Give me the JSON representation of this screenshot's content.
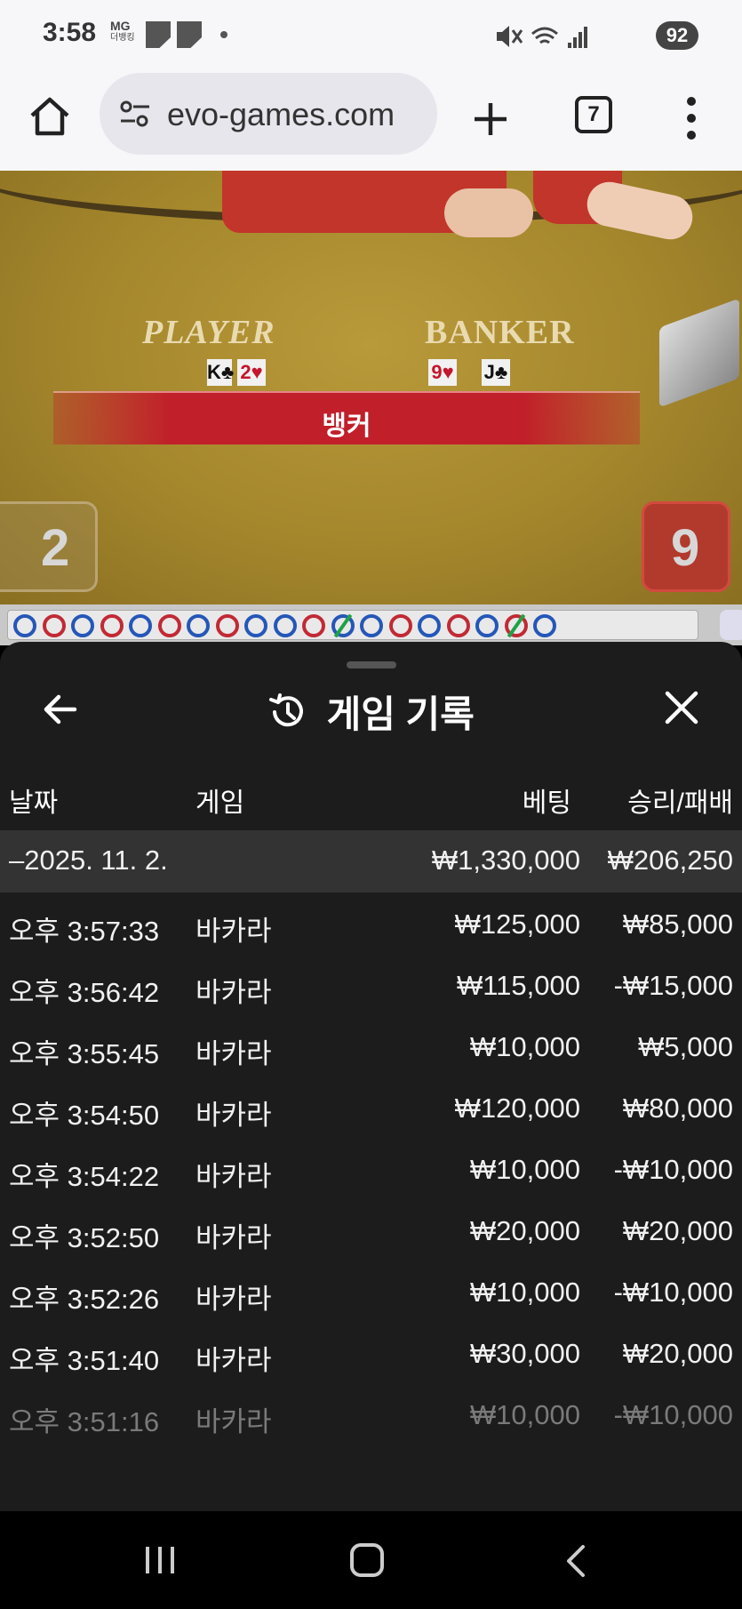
{
  "status_bar": {
    "time": "3:58",
    "carrier_top": "MG",
    "carrier_bottom": "더뱅킹",
    "battery": "92"
  },
  "browser": {
    "url": "evo-games.com",
    "tab_count": "7",
    "icons": [
      "home-icon",
      "site-settings-icon",
      "new-tab-icon",
      "tab-switcher-icon",
      "more-menu-icon"
    ]
  },
  "game": {
    "player_label": "PLAYER",
    "banker_label": "BANKER",
    "player_cards": [
      {
        "rank": "K",
        "suit": "♣",
        "color": "black"
      },
      {
        "rank": "2",
        "suit": "♥",
        "color": "red"
      }
    ],
    "banker_cards": [
      {
        "rank": "9",
        "suit": "♥",
        "color": "red"
      },
      {
        "rank": "J",
        "suit": "♣",
        "color": "black"
      }
    ],
    "result_banner": "뱅커",
    "player_score": "2",
    "banker_score": "9",
    "road": [
      "b",
      "r",
      "b",
      "r",
      "b",
      "r",
      "b",
      "r",
      "b",
      "b",
      "r",
      "b-tie",
      "b",
      "r",
      "b",
      "r",
      "b",
      "r-tie",
      "b"
    ]
  },
  "history": {
    "title": "게임 기록",
    "columns": {
      "date": "날짜",
      "game": "게임",
      "bet": "베팅",
      "winloss": "승리/패배"
    },
    "summary": {
      "date": "–2025. 11. 2.",
      "bet": "₩1,330,000",
      "winloss": "₩206,250"
    },
    "rows": [
      {
        "time": "오후 3:57:33",
        "game": "바카라",
        "bet": "₩125,000",
        "winloss": "₩85,000"
      },
      {
        "time": "오후 3:56:42",
        "game": "바카라",
        "bet": "₩115,000",
        "winloss": "-₩15,000"
      },
      {
        "time": "오후 3:55:45",
        "game": "바카라",
        "bet": "₩10,000",
        "winloss": "₩5,000"
      },
      {
        "time": "오후 3:54:50",
        "game": "바카라",
        "bet": "₩120,000",
        "winloss": "₩80,000"
      },
      {
        "time": "오후 3:54:22",
        "game": "바카라",
        "bet": "₩10,000",
        "winloss": "-₩10,000"
      },
      {
        "time": "오후 3:52:50",
        "game": "바카라",
        "bet": "₩20,000",
        "winloss": "₩20,000"
      },
      {
        "time": "오후 3:52:26",
        "game": "바카라",
        "bet": "₩10,000",
        "winloss": "-₩10,000"
      },
      {
        "time": "오후 3:51:40",
        "game": "바카라",
        "bet": "₩30,000",
        "winloss": "₩20,000"
      },
      {
        "time": "오후 3:51:16",
        "game": "바카라",
        "bet": "₩10,000",
        "winloss": "-₩10,000"
      }
    ]
  }
}
